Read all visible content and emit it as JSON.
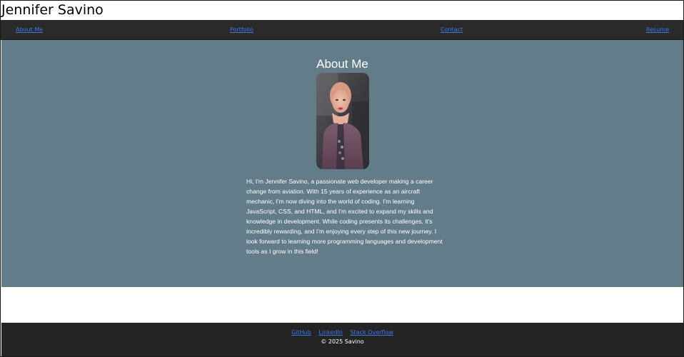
{
  "header": {
    "site_title": "Jennifer Savino"
  },
  "nav": {
    "items": [
      {
        "label": "About Me"
      },
      {
        "label": "Portfolio"
      },
      {
        "label": "Contact"
      },
      {
        "label": "Resume"
      }
    ]
  },
  "about": {
    "heading": "About Me",
    "bio": "Hi, I'm Jennifer Savino, a passionate web developer making a career change from aviation. With 15 years of experience as an aircraft mechanic, I'm now diving into the world of coding. I'm learning JavaScript, CSS, and HTML, and I'm excited to expand my skills and knowledge in development. While coding presents its challenges, it's incredibly rewarding, and I'm enjoying every step of this new journey. I look forward to learning more programming languages and development tools as I grow in this field!"
  },
  "footer": {
    "links": [
      {
        "label": "GitHub"
      },
      {
        "label": "LinkedIn"
      },
      {
        "label": "Stack Overflow"
      }
    ],
    "copyright": "© 2025 Savino"
  },
  "colors": {
    "nav_bg": "#2a2a2a",
    "section_bg": "#627c89",
    "footer_bg": "#242424",
    "link": "#3b78e7"
  }
}
